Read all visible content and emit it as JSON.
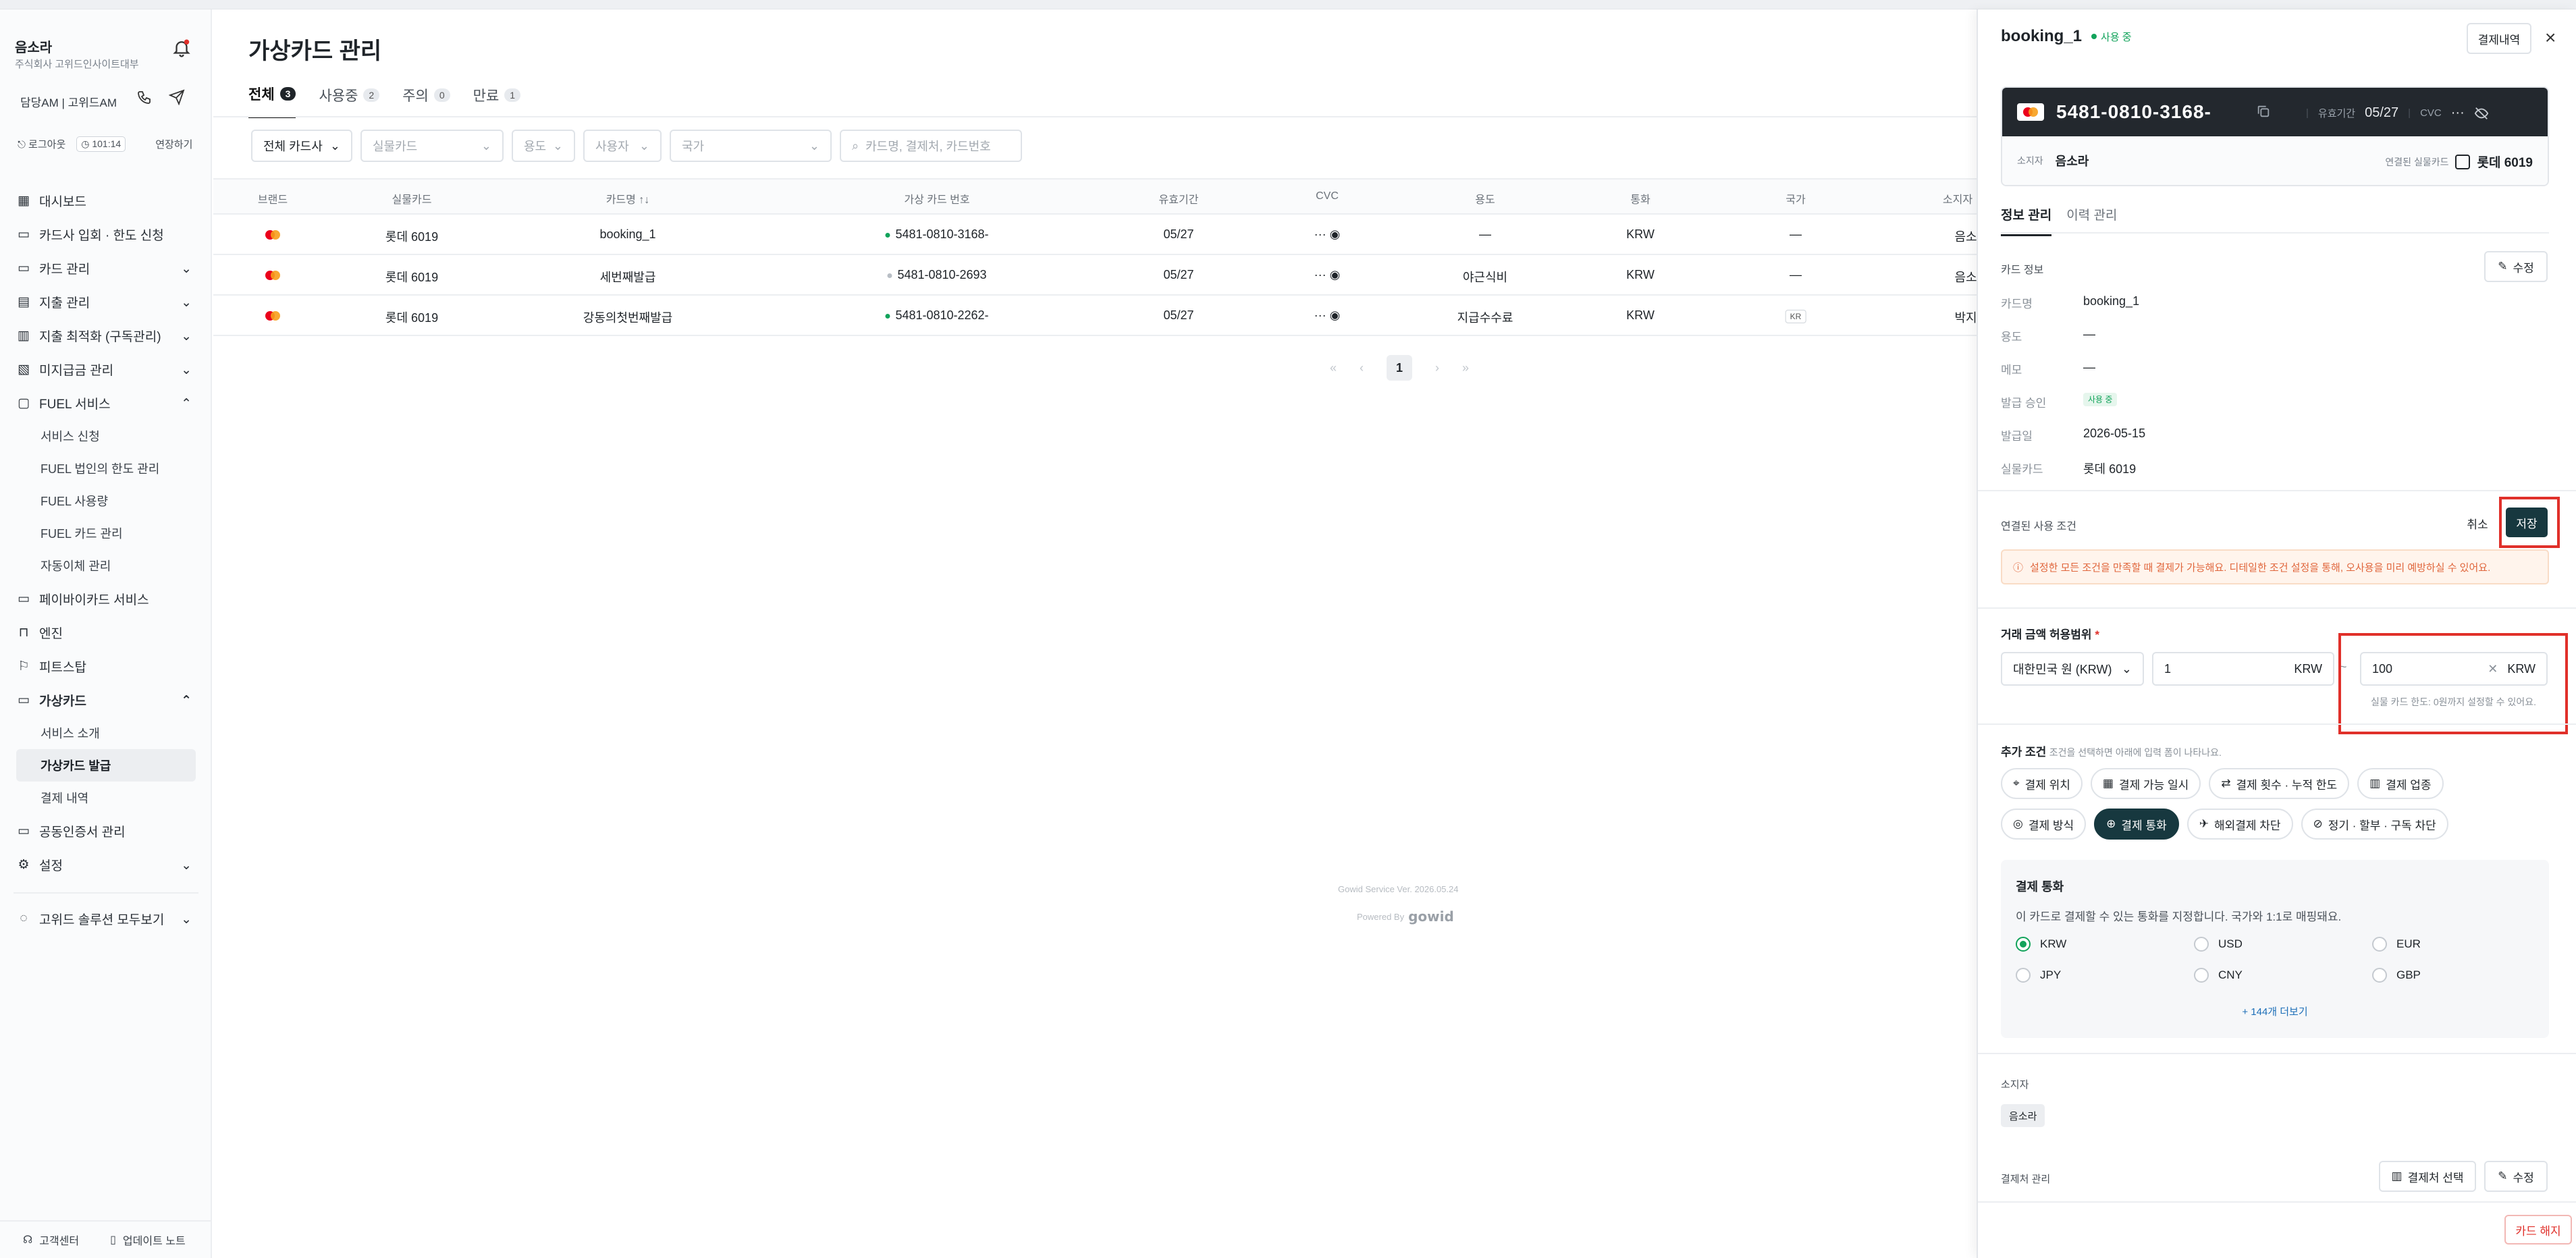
{
  "sidebar": {
    "user_name": "음소라",
    "company": "주식회사 고위드인사이트대부",
    "session_text": "담당AM | 고위드AM",
    "logout": "로그아웃",
    "timer": "101:14",
    "extend": "연장하기",
    "items": [
      {
        "label": "대시보드",
        "icon": "dashboard-icon"
      },
      {
        "label": "카드사 입회 · 한도 신청",
        "icon": "card-icon"
      },
      {
        "label": "카드 관리",
        "icon": "card-icon",
        "chevron": "down"
      },
      {
        "label": "지출 관리",
        "icon": "receipt-icon",
        "chevron": "down"
      },
      {
        "label": "지출 최적화 (구독관리)",
        "icon": "chart-icon",
        "chevron": "down"
      },
      {
        "label": "미지급금 관리",
        "icon": "doc-icon",
        "chevron": "down"
      },
      {
        "label": "FUEL 서비스",
        "icon": "fuel-icon",
        "chevron": "up"
      }
    ],
    "fuel_sub": [
      "서비스 신청",
      "FUEL 법인의 한도 관리",
      "FUEL 사용량",
      "FUEL 카드 관리",
      "자동이체 관리"
    ],
    "items2": [
      {
        "label": "페이바이카드 서비스",
        "icon": "pay-icon"
      },
      {
        "label": "엔진",
        "icon": "lock-icon"
      },
      {
        "label": "피트스탑",
        "icon": "flag-icon"
      }
    ],
    "virtual_card": {
      "label": "가상카드",
      "icon": "card-icon",
      "chevron": "up"
    },
    "virtual_sub": [
      "서비스 소개",
      "가상카드 발급",
      "결제 내역"
    ],
    "items3": [
      {
        "label": "공동인증서 관리",
        "icon": "cert-icon"
      },
      {
        "label": "설정",
        "icon": "gear-icon",
        "chevron": "down"
      }
    ],
    "solutions": "고위드 솔루션 모두보기",
    "footer_support": "고객센터",
    "footer_updates": "업데이트 노트"
  },
  "main": {
    "title": "가상카드 관리",
    "tabs": [
      {
        "label": "전체",
        "count": "3"
      },
      {
        "label": "사용중",
        "count": "2"
      },
      {
        "label": "주의",
        "count": "0"
      },
      {
        "label": "만료",
        "count": "1"
      }
    ],
    "filters": {
      "issuer": "전체 카드사",
      "real_card": "실물카드",
      "purpose": "용도",
      "user": "사용자",
      "country": "국가",
      "search_placeholder": "카드명, 결제처, 카드번호"
    },
    "columns": [
      "브랜드",
      "실물카드",
      "카드명 ↑↓",
      "가상 카드 번호",
      "유효기간",
      "CVC",
      "용도",
      "통화",
      "국가",
      "소지자"
    ],
    "rows": [
      {
        "real": "롯데 6019",
        "name": "booking_1",
        "number": "5481-0810-3168-",
        "exp": "05/27",
        "cvc": "···",
        "purpose": "—",
        "currency": "KRW",
        "country": "—",
        "holder": "음소"
      },
      {
        "real": "롯데 6019",
        "name": "세번째발급",
        "number": "5481-0810-2693",
        "exp": "05/27",
        "cvc": "···",
        "purpose": "야근식비",
        "currency": "KRW",
        "country": "—",
        "holder": "음소"
      },
      {
        "real": "롯데 6019",
        "name": "강동의첫번째발급",
        "number": "5481-0810-2262-",
        "exp": "05/27",
        "cvc": "···",
        "purpose": "지급수수료",
        "currency": "KRW",
        "country": "KR",
        "holder": "박지"
      }
    ],
    "page": "1",
    "version": "Gowid Service Ver. 2026.05.24",
    "powered": "Powered By",
    "brand": "gowid"
  },
  "drawer": {
    "title": "booking_1",
    "status": "사용 중",
    "history_btn": "결제내역",
    "card_number": "5481-0810-3168-",
    "exp_label": "유효기간",
    "exp": "05/27",
    "cvc_label": "CVC",
    "cvc": "···",
    "holder_label": "소지자",
    "holder": "음소라",
    "linked_label": "연결된 실물카드",
    "linked_card": "롯데 6019",
    "tabs": [
      "정보 관리",
      "이력 관리"
    ],
    "card_info_label": "카드 정보",
    "edit": "수정",
    "info": [
      {
        "k": "카드명",
        "v": "booking_1"
      },
      {
        "k": "용도",
        "v": "—"
      },
      {
        "k": "메모",
        "v": "—"
      },
      {
        "k": "발급 승인",
        "v": "사용 중"
      },
      {
        "k": "발급일",
        "v": "2026-05-15"
      },
      {
        "k": "실물카드",
        "v": "롯데 6019"
      }
    ],
    "conditions_label": "연결된 사용 조건",
    "cancel": "취소",
    "save": "저장",
    "warning": "설정한 모든 조건을 만족할 때 결제가 가능해요. 디테일한 조건 설정을 통해, 오사용을 미리 예방하실 수 있어요.",
    "range_label": "거래 금액 허용범위",
    "required_mark": "*",
    "currency_select": "대한민국 원 (KRW)",
    "min": "1",
    "min_unit": "KRW",
    "range_sep": "~",
    "max": "100",
    "max_unit": "KRW",
    "hint": "실물 카드 한도: 0원까지 설정할 수 있어요.",
    "extra_label": "추가 조건",
    "extra_desc": "조건을 선택하면 아래에 입력 폼이 나타나요.",
    "chips_row1": [
      "결제 위치",
      "결제 가능 일시",
      "결제 횟수 · 누적 한도",
      "결제 업종"
    ],
    "chips_row2": [
      "결제 방식",
      "결제 통화",
      "해외결제 차단",
      "정기 · 할부 · 구독 차단"
    ],
    "currency_title": "결제 통화",
    "currency_desc": "이 카드로 결제할 수 있는 통화를 지정합니다. 국가와 1:1로 매핑돼요.",
    "currencies": [
      "KRW",
      "USD",
      "EUR",
      "JPY",
      "CNY",
      "GBP"
    ],
    "more": "+ 144개 더보기",
    "owner_label": "소지자",
    "owner": "음소라",
    "merchant_label": "결제처 관리",
    "merchant_btn": "결제처 선택",
    "merchant_edit": "수정",
    "cancel_card": "카드 해지"
  }
}
